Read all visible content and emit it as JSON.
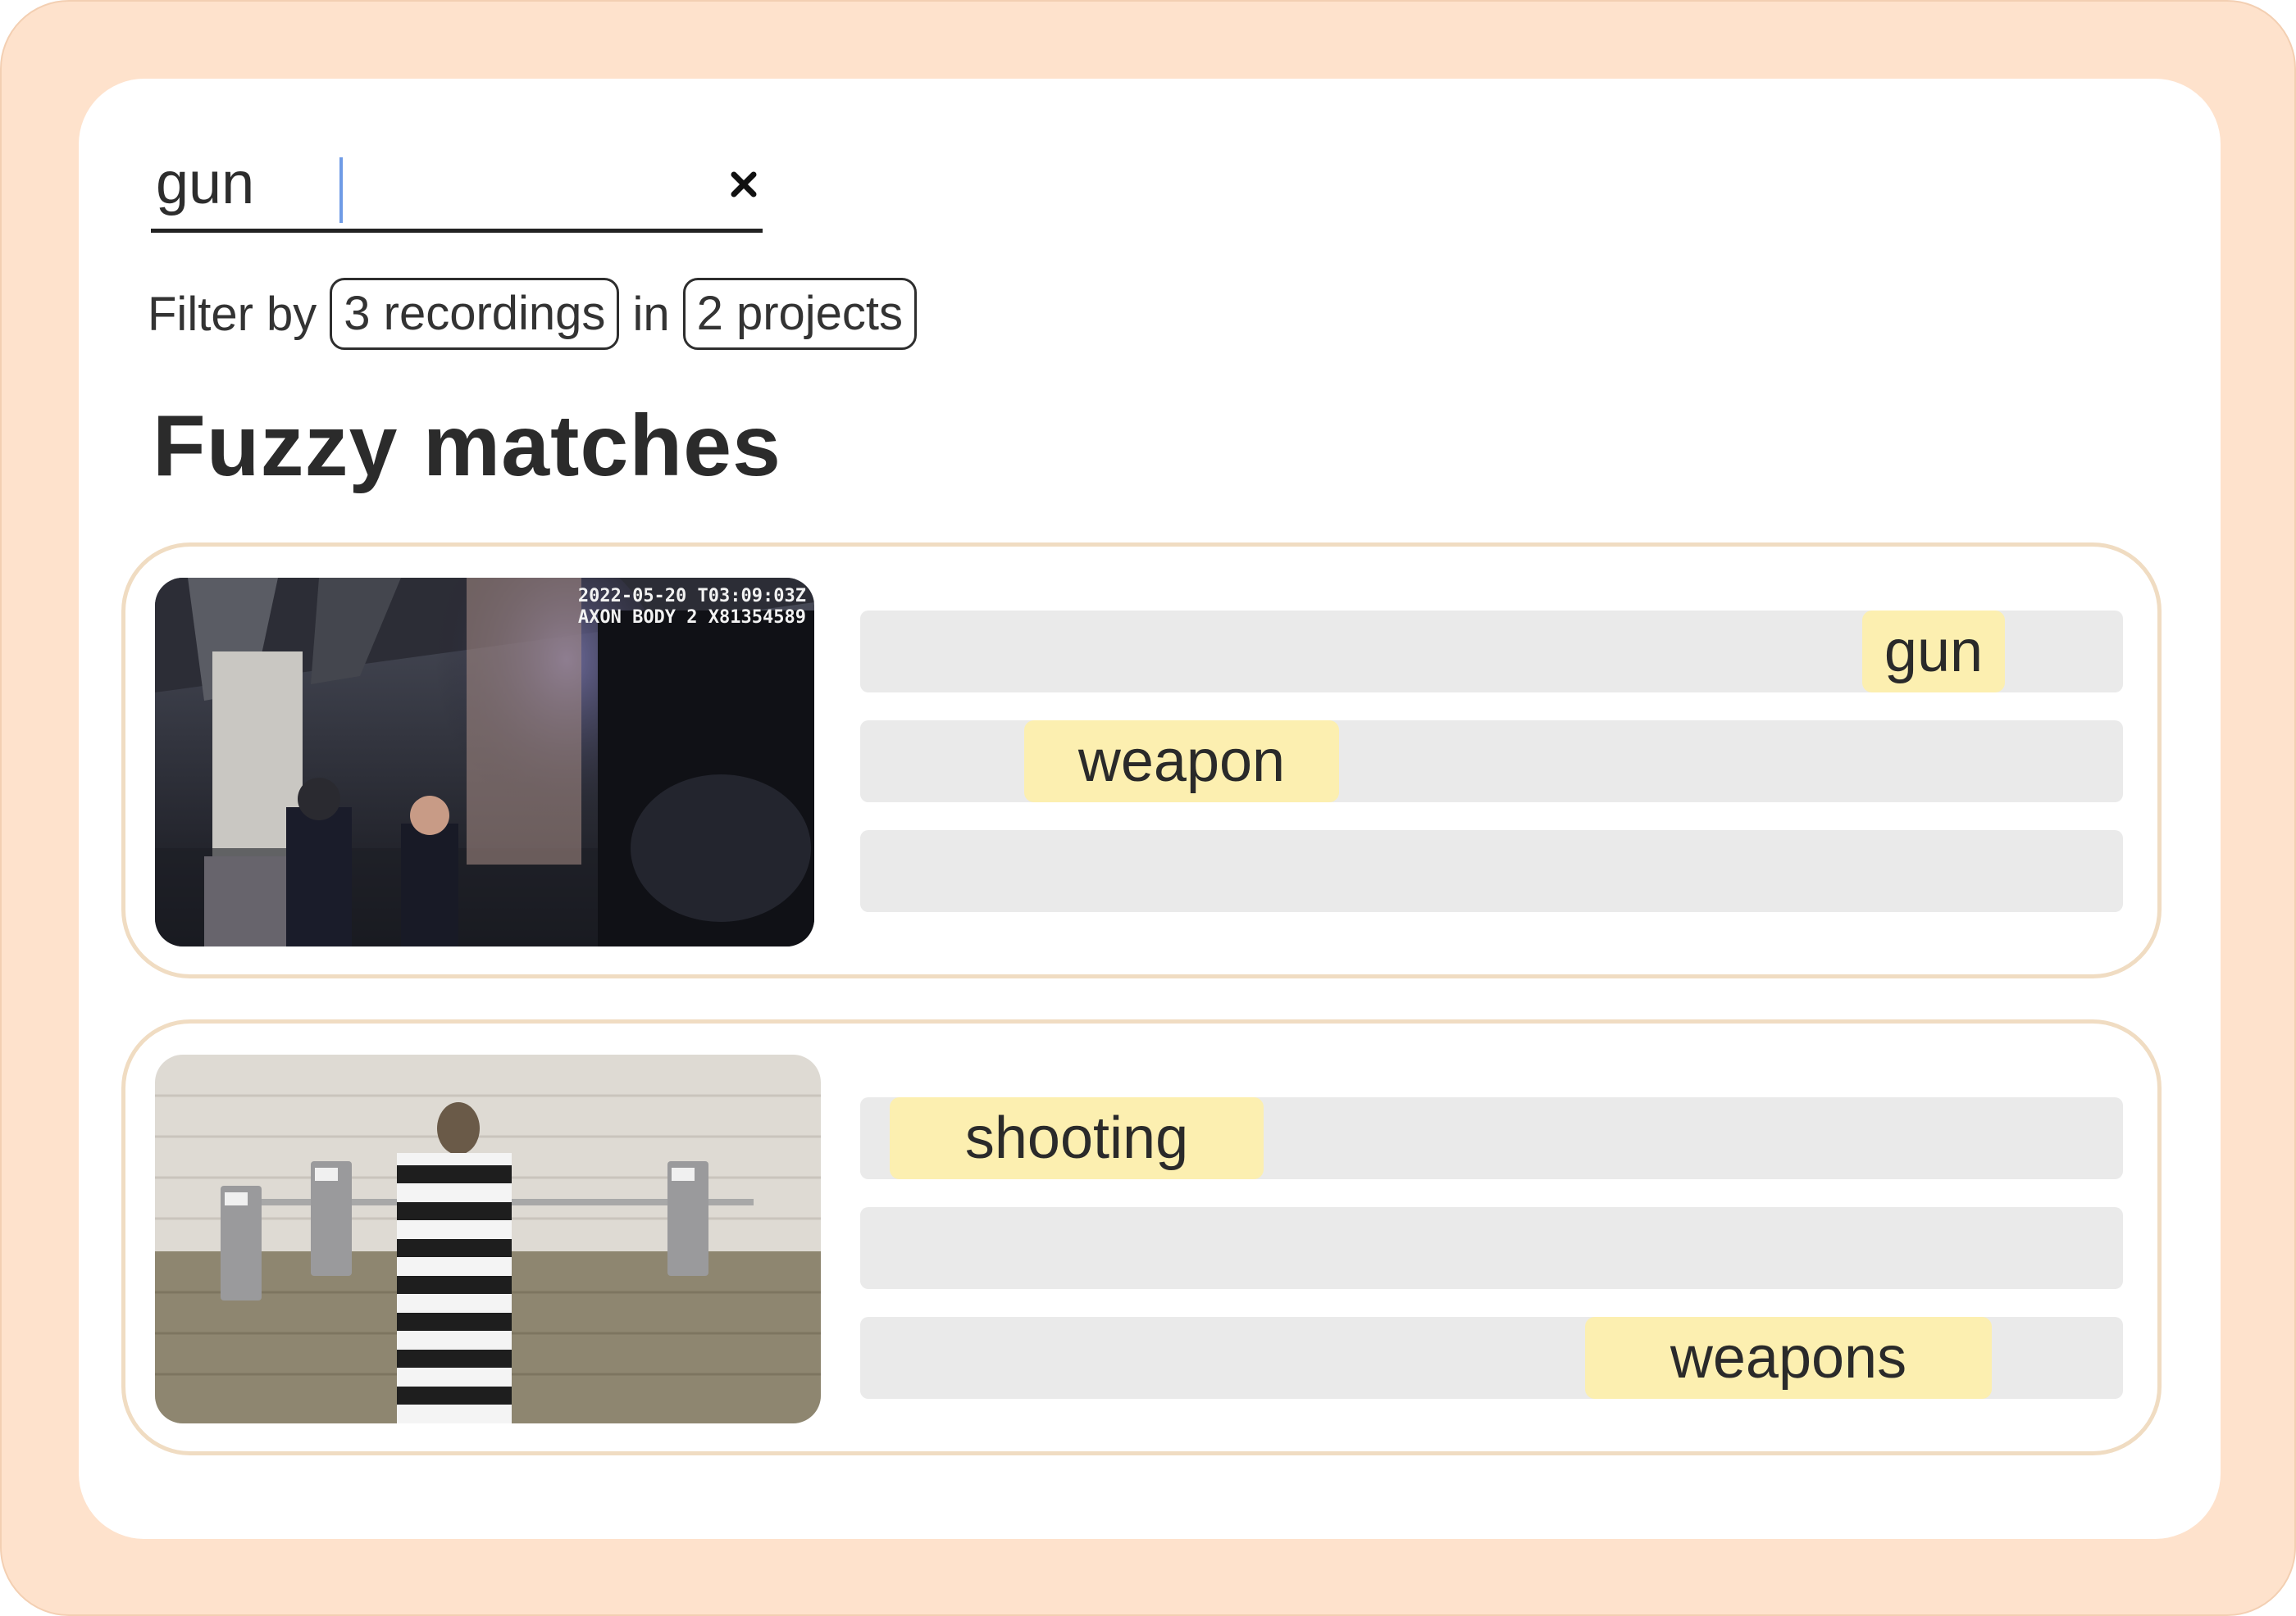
{
  "search": {
    "value": "gun",
    "clear_icon": "close-icon"
  },
  "filter": {
    "prefix": "Filter by",
    "recordings_chip": "3 recordings",
    "connector": "in",
    "projects_chip": "2 projects"
  },
  "results_heading": "Fuzzy matches",
  "results": [
    {
      "thumbnail": "bodycam-footage-thumbnail",
      "overlay_line1": "2022-05-20 T03:09:03Z",
      "overlay_line2": "AXON BODY 2 X81354589",
      "lines": [
        {
          "match": "gun"
        },
        {
          "match": "weapon"
        },
        {
          "match": ""
        }
      ]
    },
    {
      "thumbnail": "jail-payphone-thumbnail",
      "lines": [
        {
          "match": "shooting"
        },
        {
          "match": ""
        },
        {
          "match": "weapons"
        }
      ]
    }
  ],
  "colors": {
    "frame": "#fee2cc",
    "card_border": "#f0dcc2",
    "line_bar": "#eaeaea",
    "highlight": "#fcefb0",
    "caret": "#6f9be6"
  }
}
